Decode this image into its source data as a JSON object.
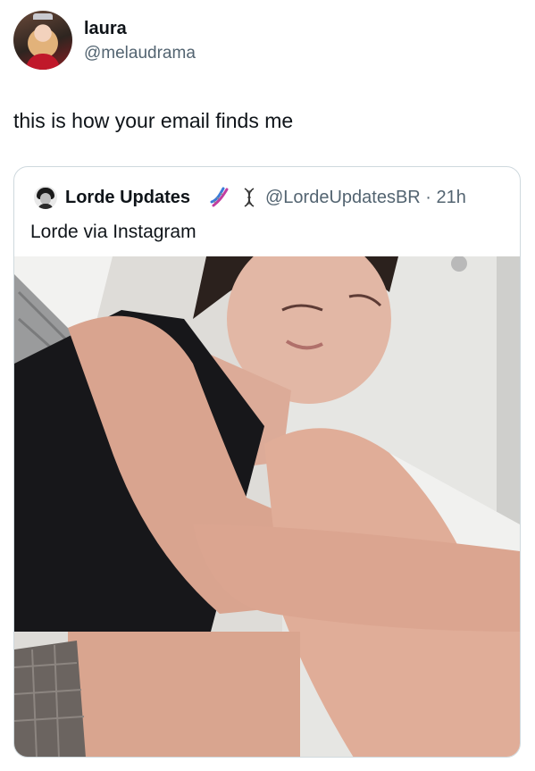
{
  "author": {
    "display_name": "laura",
    "handle": "@melaudrama",
    "avatar": "profile-avatar"
  },
  "tweet": {
    "text": "this is how your email finds me"
  },
  "quoted_tweet": {
    "display_name": "Lorde Updates",
    "emojis": [
      "dna-emoji",
      "dna-outline-emoji"
    ],
    "handle_time": "@LordeUpdatesBR · 21h",
    "text": "Lorde via Instagram",
    "media": "photo"
  },
  "colors": {
    "text": "#0f1419",
    "secondary": "#536471",
    "border": "#cfd9de"
  }
}
